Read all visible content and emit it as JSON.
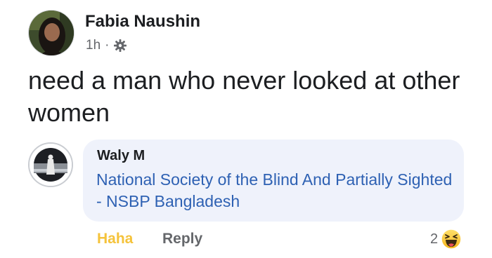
{
  "post": {
    "author": "Fabia Naushin",
    "time": "1h",
    "separator": "·",
    "privacy_icon": "gear-icon",
    "text": "need a man who never looked at other women"
  },
  "comment": {
    "author": "Waly M",
    "text": "National Society of the Blind And Partially Sighted - NSBP Bangladesh",
    "text_color": "#2e61b3",
    "actions": {
      "haha_label": "Haha",
      "reply_label": "Reply"
    },
    "reactions": {
      "count": "2",
      "icon": "haha-emoji-icon"
    }
  },
  "colors": {
    "bubble_background": "#eff2fb",
    "haha_yellow": "#f5c33b",
    "secondary_text": "#65676b"
  }
}
